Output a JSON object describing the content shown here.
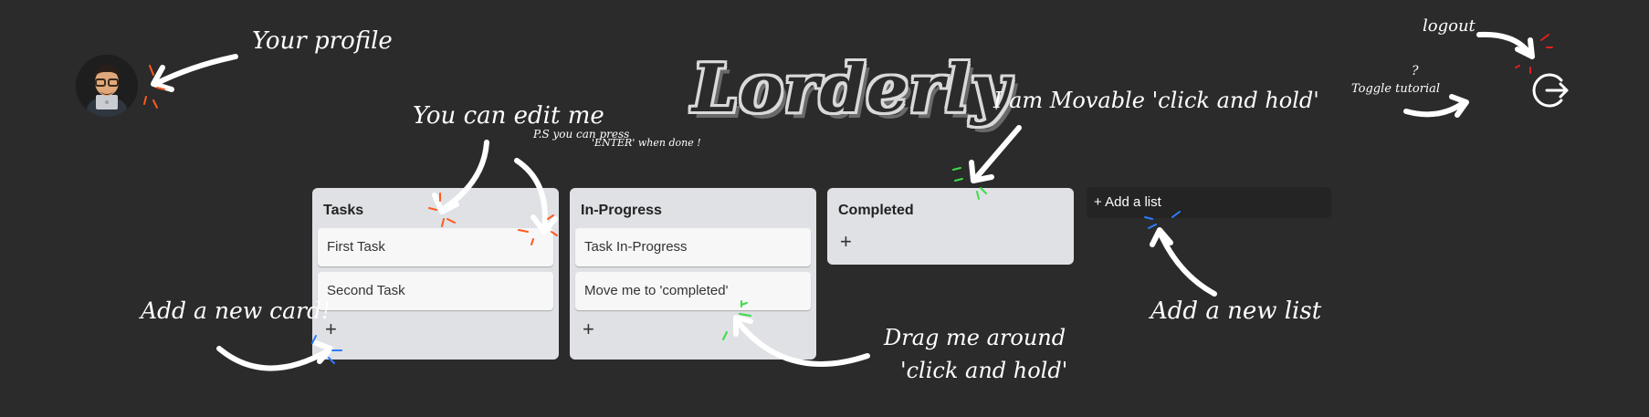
{
  "app": {
    "logo_text": "Lorderly"
  },
  "lists": [
    {
      "title": "Tasks",
      "cards": [
        "First Task",
        "Second Task"
      ],
      "add_label": "+"
    },
    {
      "title": "In-Progress",
      "cards": [
        "Task In-Progress",
        "Move me to 'completed'"
      ],
      "add_label": "+"
    },
    {
      "title": "Completed",
      "cards": [],
      "add_label": "+"
    }
  ],
  "add_list": {
    "label": "+ Add a list"
  },
  "annotations": {
    "profile": "Your profile",
    "edit": "You can edit me",
    "edit_ps_1": "P.S you can press",
    "edit_ps_2": "'ENTER' when done !",
    "movable": "I am Movable 'click and hold'",
    "logout": "logout",
    "toggle_q": "?",
    "toggle": "Toggle tutorial",
    "add_card": "Add a new card!",
    "drag_1": "Drag me around",
    "drag_2": "'click and hold'",
    "add_list": "Add a new list"
  },
  "icons": {
    "avatar": "memoji-avatar-icon",
    "logout": "logout-icon"
  },
  "colors": {
    "background": "#2b2b2b",
    "list_bg": "#dfe1e4",
    "card_bg": "#f7f7f8",
    "accent_orange": "#ff5a1f",
    "accent_green": "#3ddc4a",
    "accent_blue": "#2f7bff",
    "accent_red": "#e02020"
  }
}
